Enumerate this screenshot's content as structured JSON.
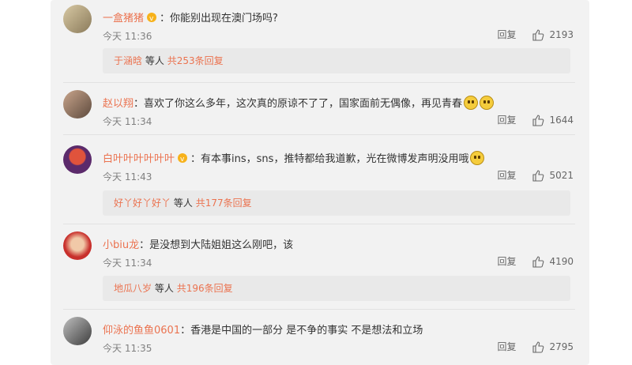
{
  "comments": [
    {
      "username": "一盒猪猪",
      "text": "你能别出现在澳门场吗?",
      "time": "今天 11:36",
      "reply_label": "回复",
      "likes": "2193",
      "replies": {
        "user": "于涵晗",
        "suffix": "等人",
        "count_text": "共253条回复"
      }
    },
    {
      "username": "赵以翔",
      "text": "喜欢了你这么多年，这次真的原谅不了了，国家面前无偶像，再见青春",
      "time": "今天 11:34",
      "reply_label": "回复",
      "likes": "1644"
    },
    {
      "username": "白叶叶叶叶叶叶",
      "text": "有本事ins，sns，推特都给我道歉，光在微博发声明没用哦",
      "time": "今天 11:43",
      "reply_label": "回复",
      "likes": "5021",
      "replies": {
        "user": "好丫好丫好丫",
        "suffix": "等人",
        "count_text": "共177条回复"
      }
    },
    {
      "username": "小biu龙",
      "text": "是没想到大陆姐姐这么刚吧，该",
      "time": "今天 11:34",
      "reply_label": "回复",
      "likes": "4190",
      "replies": {
        "user": "地瓜八岁",
        "suffix": "等人",
        "count_text": "共196条回复"
      }
    },
    {
      "username": "仰泳的鱼鱼0601",
      "text": "香港是中国的一部分 是不争的事实 不是想法和立场",
      "time": "今天 11:35",
      "reply_label": "回复",
      "likes": "2795"
    }
  ],
  "separator": "：",
  "icons": {
    "vip": "vip-badge-icon",
    "like": "thumbs-up-icon",
    "emoji": "crying-laugh-emoji-icon"
  },
  "colors": {
    "username": "#eb7350",
    "panel": "#f2f2f2",
    "reply_box": "#e9e9e9"
  }
}
